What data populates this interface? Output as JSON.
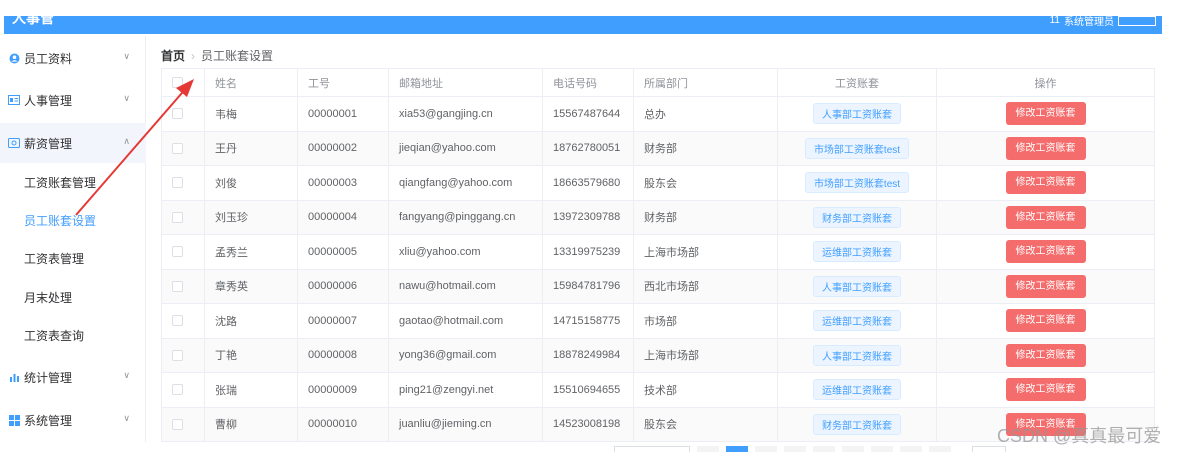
{
  "header": {
    "logo": "人事管",
    "user_count": "11",
    "user_label": "系统管理员"
  },
  "sidebar": {
    "items": [
      {
        "label": "员工资料",
        "icon": "person-icon"
      },
      {
        "label": "人事管理",
        "icon": "id-card-icon"
      },
      {
        "label": "薪资管理",
        "icon": "wallet-icon"
      },
      {
        "label": "统计管理",
        "icon": "bar-chart-icon"
      },
      {
        "label": "系统管理",
        "icon": "windows-icon"
      }
    ],
    "sub_items": [
      {
        "label": "工资账套管理"
      },
      {
        "label": "员工账套设置"
      },
      {
        "label": "工资表管理"
      },
      {
        "label": "月末处理"
      },
      {
        "label": "工资表查询"
      }
    ]
  },
  "breadcrumb": {
    "home": "首页",
    "current": "员工账套设置"
  },
  "table": {
    "headers": {
      "name": "姓名",
      "id": "工号",
      "email": "邮箱地址",
      "phone": "电话号码",
      "dept": "所属部门",
      "salary": "工资账套",
      "action": "操作"
    },
    "rows": [
      {
        "name": "韦梅",
        "id": "00000001",
        "email": "xia53@gangjing.cn",
        "phone": "15567487644",
        "dept": "总办",
        "salary": "人事部工资账套",
        "action": "修改工资账套"
      },
      {
        "name": "王丹",
        "id": "00000002",
        "email": "jieqian@yahoo.com",
        "phone": "18762780051",
        "dept": "财务部",
        "salary": "市场部工资账套test",
        "action": "修改工资账套"
      },
      {
        "name": "刘俊",
        "id": "00000003",
        "email": "qiangfang@yahoo.com",
        "phone": "18663579680",
        "dept": "股东会",
        "salary": "市场部工资账套test",
        "action": "修改工资账套"
      },
      {
        "name": "刘玉珍",
        "id": "00000004",
        "email": "fangyang@pinggang.cn",
        "phone": "13972309788",
        "dept": "财务部",
        "salary": "财务部工资账套",
        "action": "修改工资账套"
      },
      {
        "name": "孟秀兰",
        "id": "00000005",
        "email": "xliu@yahoo.com",
        "phone": "13319975239",
        "dept": "上海市场部",
        "salary": "运维部工资账套",
        "action": "修改工资账套"
      },
      {
        "name": "章秀英",
        "id": "00000006",
        "email": "nawu@hotmail.com",
        "phone": "15984781796",
        "dept": "西北市场部",
        "salary": "人事部工资账套",
        "action": "修改工资账套"
      },
      {
        "name": "沈路",
        "id": "00000007",
        "email": "gaotao@hotmail.com",
        "phone": "14715158775",
        "dept": "市场部",
        "salary": "运维部工资账套",
        "action": "修改工资账套"
      },
      {
        "name": "丁艳",
        "id": "00000008",
        "email": "yong36@gmail.com",
        "phone": "18878249984",
        "dept": "上海市场部",
        "salary": "人事部工资账套",
        "action": "修改工资账套"
      },
      {
        "name": "张瑞",
        "id": "00000009",
        "email": "ping21@zengyi.net",
        "phone": "15510694655",
        "dept": "技术部",
        "salary": "运维部工资账套",
        "action": "修改工资账套"
      },
      {
        "name": "曹柳",
        "id": "00000010",
        "email": "juanliu@jieming.cn",
        "phone": "14523008198",
        "dept": "股东会",
        "salary": "财务部工资账套",
        "action": "修改工资账套"
      }
    ]
  },
  "watermark": "CSDN @真真最可爱",
  "colors": {
    "primary": "#409eff",
    "danger": "#f56c6c",
    "annotation": "#e53935"
  }
}
